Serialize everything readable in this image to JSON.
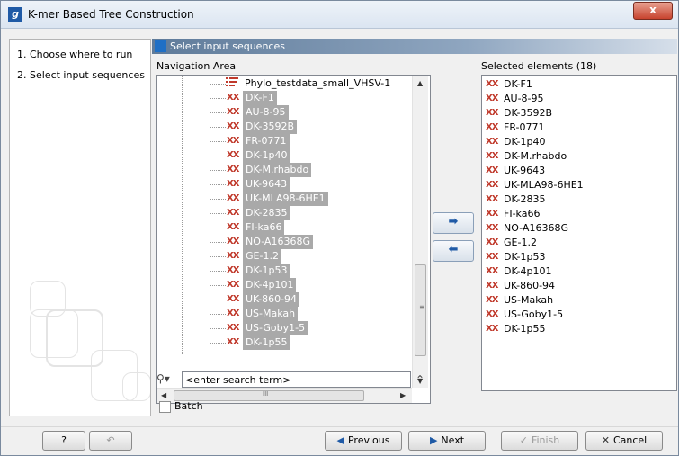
{
  "window": {
    "title": "K-mer Based Tree Construction",
    "app_icon": "g",
    "close_glyph": "x"
  },
  "steps": [
    {
      "label": "1.  Choose where to run"
    },
    {
      "label": "2.  Select input sequences"
    }
  ],
  "panel": {
    "title": "Select input sequences"
  },
  "navigation": {
    "label": "Navigation Area",
    "parent_item": "Phylo_testdata_small_VHSV-1",
    "items": [
      "DK-F1",
      "AU-8-95",
      "DK-3592B",
      "FR-0771",
      "DK-1p40",
      "DK-M.rhabdo",
      "UK-9643",
      "UK-MLA98-6HE1",
      "DK-2835",
      "FI-ka66",
      "NO-A16368G",
      "GE-1.2",
      "DK-1p53",
      "DK-4p101",
      "UK-860-94",
      "US-Makah",
      "US-Goby1-5",
      "DK-1p55"
    ],
    "hscroll_mid": "III"
  },
  "search": {
    "placeholder": "<enter search term>"
  },
  "batch": {
    "label": "Batch",
    "checked": false
  },
  "move_buttons": {
    "add": "➡",
    "remove": "⬅"
  },
  "selected": {
    "label": "Selected elements (18)",
    "items": [
      "DK-F1",
      "AU-8-95",
      "DK-3592B",
      "FR-0771",
      "DK-1p40",
      "DK-M.rhabdo",
      "UK-9643",
      "UK-MLA98-6HE1",
      "DK-2835",
      "FI-ka66",
      "NO-A16368G",
      "GE-1.2",
      "DK-1p53",
      "DK-4p101",
      "UK-860-94",
      "US-Makah",
      "US-Goby1-5",
      "DK-1p55"
    ]
  },
  "footer": {
    "help": "?",
    "previous": "Previous",
    "next": "Next",
    "finish": "Finish",
    "cancel": "Cancel"
  },
  "colors": {
    "accent": "#1f5aa6",
    "selection": "#a9a9a9",
    "sequence_icon": "#c0392b"
  }
}
